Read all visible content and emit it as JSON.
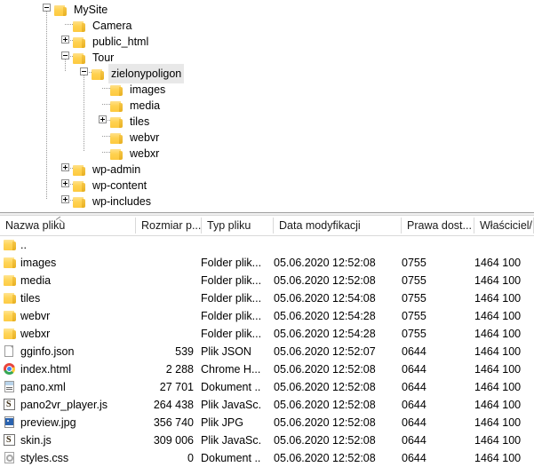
{
  "tree": {
    "nodes": [
      {
        "label": "MySite",
        "depth": 1,
        "toggle": "minus",
        "icon": "folder-icon",
        "selected": false
      },
      {
        "label": "Camera",
        "depth": 2,
        "toggle": "none",
        "icon": "folder-icon",
        "selected": false
      },
      {
        "label": "public_html",
        "depth": 2,
        "toggle": "plus",
        "icon": "folder-icon",
        "selected": false
      },
      {
        "label": "Tour",
        "depth": 2,
        "toggle": "minus",
        "icon": "folder-icon",
        "selected": false
      },
      {
        "label": "zielonypoligon",
        "depth": 3,
        "toggle": "minus",
        "icon": "folder-icon",
        "selected": true
      },
      {
        "label": "images",
        "depth": 4,
        "toggle": "none",
        "icon": "folder-icon",
        "selected": false
      },
      {
        "label": "media",
        "depth": 4,
        "toggle": "none",
        "icon": "folder-icon",
        "selected": false
      },
      {
        "label": "tiles",
        "depth": 4,
        "toggle": "plus",
        "icon": "folder-icon",
        "selected": false
      },
      {
        "label": "webvr",
        "depth": 4,
        "toggle": "none",
        "icon": "folder-icon",
        "selected": false
      },
      {
        "label": "webxr",
        "depth": 4,
        "toggle": "none",
        "icon": "folder-icon",
        "selected": false
      },
      {
        "label": "wp-admin",
        "depth": 2,
        "toggle": "plus",
        "icon": "folder-icon",
        "selected": false
      },
      {
        "label": "wp-content",
        "depth": 2,
        "toggle": "plus",
        "icon": "folder-icon",
        "selected": false
      },
      {
        "label": "wp-includes",
        "depth": 2,
        "toggle": "plus",
        "icon": "folder-icon",
        "selected": false
      }
    ]
  },
  "list": {
    "columns": [
      {
        "label": "Nazwa pliku",
        "key": "name"
      },
      {
        "label": "Rozmiar p...",
        "key": "size"
      },
      {
        "label": "Typ pliku",
        "key": "type"
      },
      {
        "label": "Data modyfikacji",
        "key": "date"
      },
      {
        "label": "Prawa dost...",
        "key": "perm"
      },
      {
        "label": "Właściciel/...",
        "key": "owner"
      }
    ],
    "sort": {
      "column": "Nazwa pliku",
      "direction": "ascending"
    },
    "rows": [
      {
        "icon": "folder-icon",
        "name": "..",
        "size": "",
        "type": "",
        "date": "",
        "perm": "",
        "owner": ""
      },
      {
        "icon": "folder-icon",
        "name": "images",
        "size": "",
        "type": "Folder plik...",
        "date": "05.06.2020 12:52:08",
        "perm": "0755",
        "owner": "1464 100"
      },
      {
        "icon": "folder-icon",
        "name": "media",
        "size": "",
        "type": "Folder plik...",
        "date": "05.06.2020 12:52:08",
        "perm": "0755",
        "owner": "1464 100"
      },
      {
        "icon": "folder-icon",
        "name": "tiles",
        "size": "",
        "type": "Folder plik...",
        "date": "05.06.2020 12:54:08",
        "perm": "0755",
        "owner": "1464 100"
      },
      {
        "icon": "folder-icon",
        "name": "webvr",
        "size": "",
        "type": "Folder plik...",
        "date": "05.06.2020 12:54:28",
        "perm": "0755",
        "owner": "1464 100"
      },
      {
        "icon": "folder-icon",
        "name": "webxr",
        "size": "",
        "type": "Folder plik...",
        "date": "05.06.2020 12:54:28",
        "perm": "0755",
        "owner": "1464 100"
      },
      {
        "icon": "document-icon",
        "name": "gginfo.json",
        "size": "539",
        "type": "Plik JSON",
        "date": "05.06.2020 12:52:07",
        "perm": "0644",
        "owner": "1464 100"
      },
      {
        "icon": "chrome-icon",
        "name": "index.html",
        "size": "2 288",
        "type": "Chrome H...",
        "date": "05.06.2020 12:52:08",
        "perm": "0644",
        "owner": "1464 100"
      },
      {
        "icon": "xml-document-icon",
        "name": "pano.xml",
        "size": "27 701",
        "type": "Dokument ...",
        "date": "05.06.2020 12:52:08",
        "perm": "0644",
        "owner": "1464 100"
      },
      {
        "icon": "javascript-icon",
        "name": "pano2vr_player.js",
        "size": "264 438",
        "type": "Plik JavaSc...",
        "date": "05.06.2020 12:52:08",
        "perm": "0644",
        "owner": "1464 100"
      },
      {
        "icon": "jpg-image-icon",
        "name": "preview.jpg",
        "size": "356 740",
        "type": "Plik JPG",
        "date": "05.06.2020 12:52:08",
        "perm": "0644",
        "owner": "1464 100"
      },
      {
        "icon": "javascript-icon",
        "name": "skin.js",
        "size": "309 006",
        "type": "Plik JavaSc...",
        "date": "05.06.2020 12:52:08",
        "perm": "0644",
        "owner": "1464 100"
      },
      {
        "icon": "css-document-icon",
        "name": "styles.css",
        "size": "0",
        "type": "Dokument ...",
        "date": "05.06.2020 12:52:08",
        "perm": "0644",
        "owner": "1464 100"
      }
    ]
  },
  "colors": {
    "folder": "#ffd558",
    "selection": "#e8e8e8",
    "header_rule": "#d9d9d9",
    "guide_line": "#9a9a9a"
  }
}
